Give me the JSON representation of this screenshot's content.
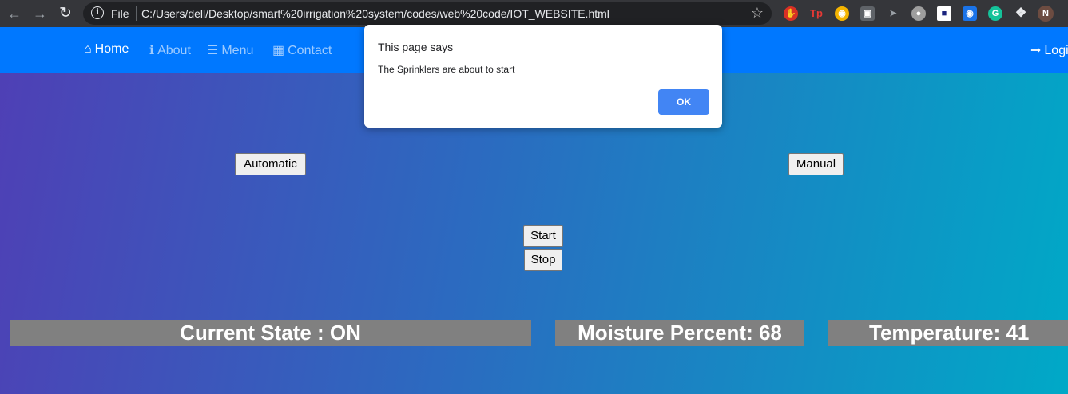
{
  "browser": {
    "back_icon": "arrow-left",
    "forward_icon": "arrow-right",
    "reload_icon": "reload",
    "file_label": "File",
    "url": "C:/Users/dell/Desktop/smart%20irrigation%20system/codes/web%20code/IOT_WEBSITE.html",
    "profile_initial": "N"
  },
  "navbar": {
    "home_label": "Home",
    "about_label": "About",
    "menu_label": "Menu",
    "contact_label": "Contact",
    "login_label": "Login"
  },
  "controls": {
    "automatic_label": "Automatic",
    "manual_label": "Manual",
    "start_label": "Start",
    "stop_label": "Stop"
  },
  "status": {
    "current_state": "Current State : ON",
    "moisture": "Moisture Percent: 68",
    "temperature": "Temperature: 41"
  },
  "dialog": {
    "title": "This page says",
    "message": "The Sprinklers are about to start",
    "ok_label": "OK"
  },
  "colors": {
    "navbar": "#0078ff",
    "stat_bg": "#808080",
    "ok_button": "#4285f4"
  }
}
